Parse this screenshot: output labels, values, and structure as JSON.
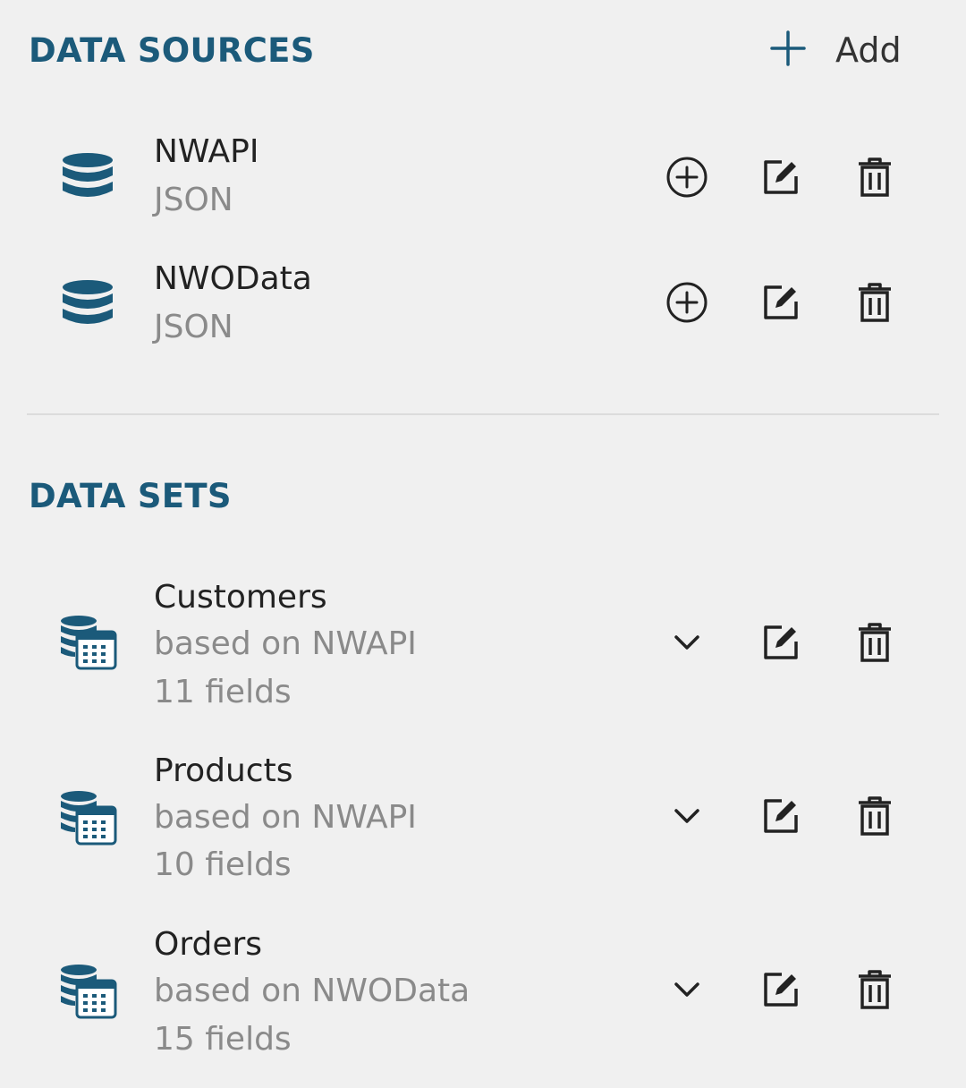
{
  "data_sources": {
    "title": "DATA SOURCES",
    "add_label": "Add",
    "items": [
      {
        "name": "NWAPI",
        "type": "JSON"
      },
      {
        "name": "NWOData",
        "type": "JSON"
      }
    ]
  },
  "data_sets": {
    "title": "DATA SETS",
    "items": [
      {
        "name": "Customers",
        "based_on": "based on NWAPI",
        "fields": "11 fields"
      },
      {
        "name": "Products",
        "based_on": "based on NWAPI",
        "fields": "10 fields"
      },
      {
        "name": "Orders",
        "based_on": "based on NWOData",
        "fields": "15 fields"
      }
    ]
  },
  "colors": {
    "accent": "#1b5a7a",
    "text": "#222222",
    "muted": "#8a8a8a",
    "background": "#f0f0f0"
  },
  "icons": [
    "database-icon",
    "dataset-icon",
    "add-circle-icon",
    "edit-icon",
    "delete-icon",
    "chevron-down-icon",
    "plus-icon"
  ]
}
